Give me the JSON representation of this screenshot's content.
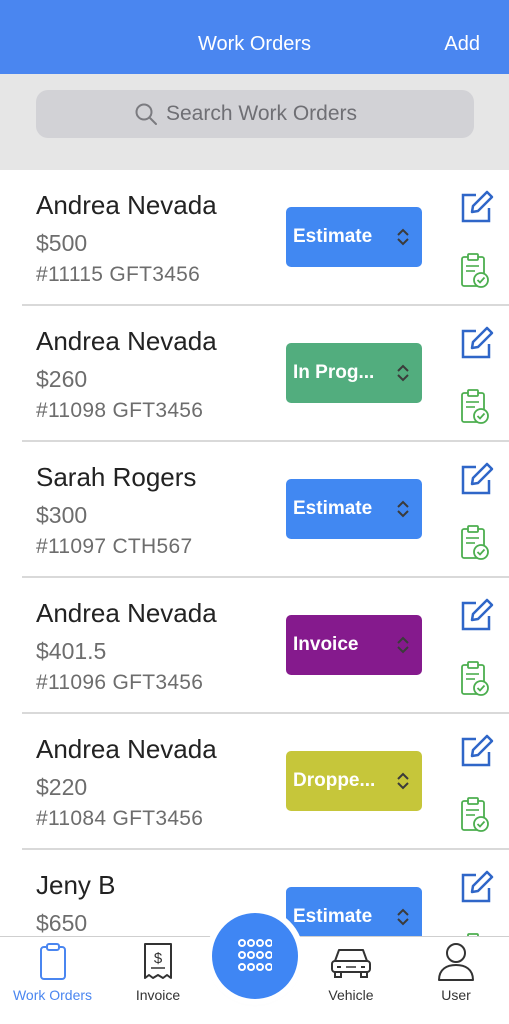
{
  "header": {
    "title": "Work Orders",
    "add_label": "Add"
  },
  "search": {
    "placeholder": "Search Work Orders"
  },
  "orders": [
    {
      "name": "Andrea Nevada",
      "amount": "$500",
      "ref": "#11115 GFT3456",
      "status": "Estimate",
      "status_color": "#4188f2"
    },
    {
      "name": "Andrea Nevada",
      "amount": "$260",
      "ref": "#11098 GFT3456",
      "status": "In Prog...",
      "status_color": "#52ad7e"
    },
    {
      "name": "Sarah Rogers",
      "amount": "$300",
      "ref": "#11097 CTH567",
      "status": "Estimate",
      "status_color": "#4188f2"
    },
    {
      "name": "Andrea Nevada",
      "amount": "$401.5",
      "ref": "#11096 GFT3456",
      "status": "Invoice",
      "status_color": "#851a8d"
    },
    {
      "name": "Andrea Nevada",
      "amount": "$220",
      "ref": "#11084 GFT3456",
      "status": "Droppe...",
      "status_color": "#c6c63a"
    },
    {
      "name": "Jeny B",
      "amount": "$650",
      "ref": "",
      "status": "Estimate",
      "status_color": "#4188f2"
    }
  ],
  "tabs": [
    {
      "label": "Work Orders",
      "icon": "clipboard-icon",
      "active": true
    },
    {
      "label": "Invoice",
      "icon": "receipt-icon",
      "active": false
    },
    {
      "label": "Vehicle",
      "icon": "car-icon",
      "active": false
    },
    {
      "label": "User",
      "icon": "user-icon",
      "active": false
    }
  ],
  "colors": {
    "accent": "#4a86f0",
    "edit_icon": "#2f66c8",
    "clipboard_icon": "#4cae4f"
  }
}
